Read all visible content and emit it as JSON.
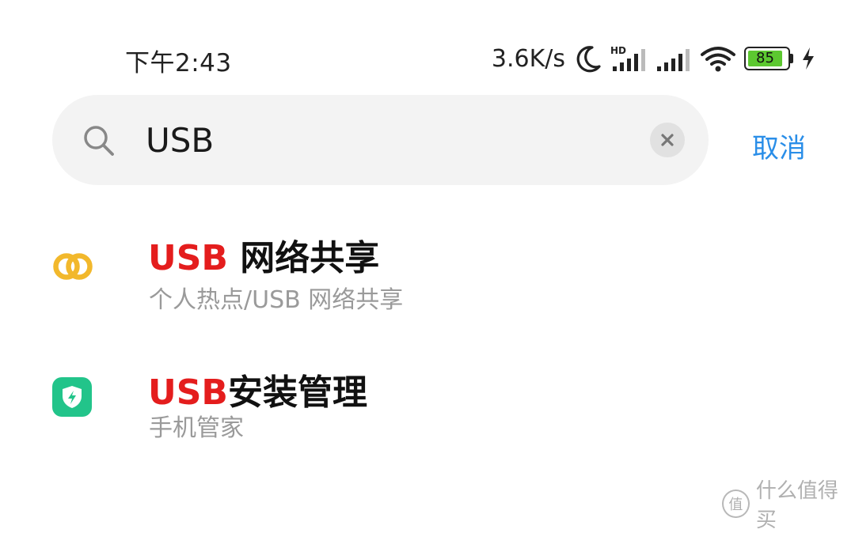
{
  "status_bar": {
    "time": "下午2:43",
    "net_speed": "3.6K/s",
    "hd_label": "HD",
    "battery_level": "85",
    "icons": [
      "moon-icon",
      "hd-signal-icon",
      "signal-icon",
      "wifi-icon",
      "battery-icon",
      "charging-icon"
    ]
  },
  "search": {
    "query": "USB",
    "cancel_label": "取消",
    "icons": [
      "search-icon",
      "clear-icon"
    ]
  },
  "results": [
    {
      "title_highlight": "USB",
      "title_rest": " 网络共享",
      "subtitle": "个人热点/USB 网络共享",
      "icon": "link-rings-icon"
    },
    {
      "title_highlight": "USB",
      "title_rest": "安装管理",
      "subtitle": "手机管家",
      "icon": "security-shield-icon"
    }
  ],
  "watermark": {
    "symbol": "值",
    "text": "什么值得买"
  },
  "colors": {
    "accent_blue": "#2a8ee8",
    "highlight_red": "#e41d1d",
    "battery_green": "#5cc830",
    "ring_yellow": "#f2b82c",
    "shield_green": "#22c48a"
  }
}
